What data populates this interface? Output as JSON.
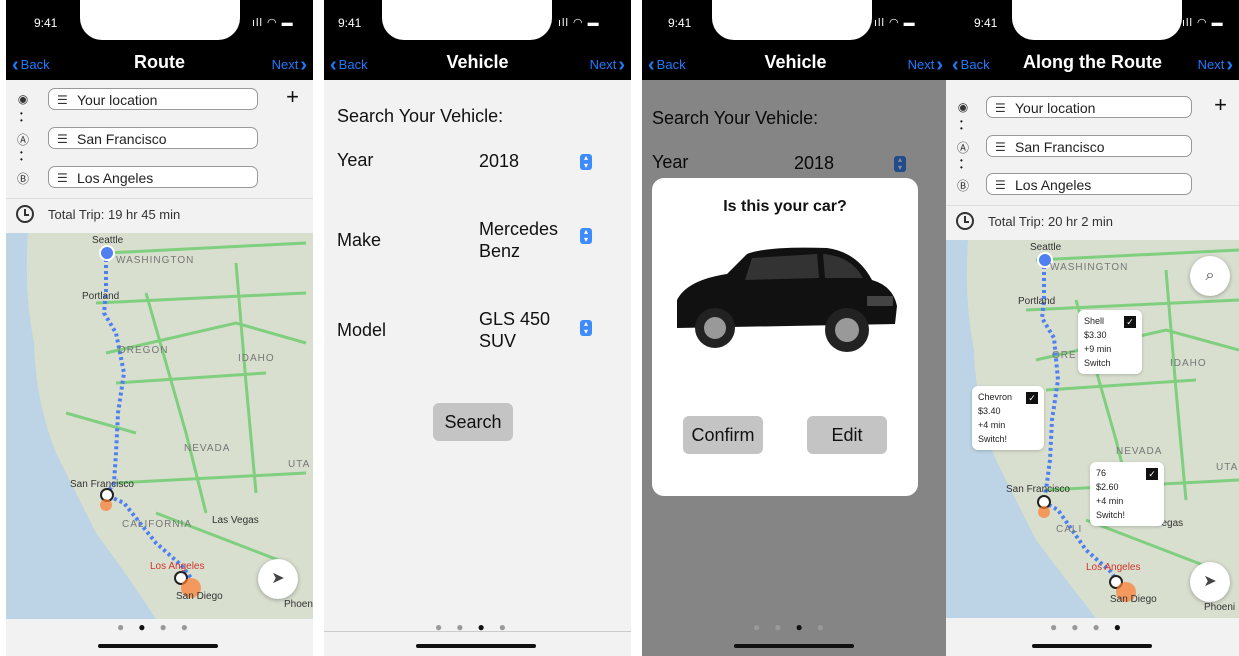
{
  "status": {
    "time": "9:41",
    "signal": "ıll"
  },
  "nav": {
    "back": "Back",
    "next": "Next"
  },
  "screens": {
    "route": {
      "title": "Route",
      "fields": [
        "Your location",
        "San Francisco",
        "Los Angeles"
      ],
      "markers": [
        "◉",
        "Ⓐ",
        "Ⓑ"
      ],
      "trip": "Total Trip: 19 hr 45 min",
      "map_labels": {
        "seattle": "Seattle",
        "washington": "WASHINGTON",
        "portland": "Portland",
        "oregon": "OREGON",
        "idaho": "IDAHO",
        "nevada": "NEVADA",
        "sanfrancisco": "San Francisco",
        "california": "CALIFORNIA",
        "lasvegas": "Las Vegas",
        "losangeles": "Los Angeles",
        "sandiego": "San Diego",
        "phoenix": "Phoeni",
        "utah": "UTA"
      }
    },
    "vehicle": {
      "title": "Vehicle",
      "heading": "Search Your Vehicle:",
      "year_label": "Year",
      "year_value": "2018",
      "make_label": "Make",
      "make_value_1": "Mercedes",
      "make_value_2": "Benz",
      "model_label": "Model",
      "model_value_1": "GLS 450",
      "model_value_2": "SUV",
      "search_button": "Search"
    },
    "confirm": {
      "title": "Vehicle",
      "heading": "Search Your Vehicle:",
      "year_label": "Year",
      "year_value": "2018",
      "modal_title": "Is this your car?",
      "confirm_button": "Confirm",
      "edit_button": "Edit"
    },
    "along": {
      "title": "Along the Route",
      "fields": [
        "Your location",
        "San Francisco",
        "Los Angeles"
      ],
      "trip": "Total Trip: 20 hr 2 min",
      "stations": [
        {
          "name": "Shell",
          "price": "$3.30",
          "time": "+9 min",
          "action": "Switch"
        },
        {
          "name": "Chevron",
          "price": "$3.40",
          "time": "+4 min",
          "action": "Switch!"
        },
        {
          "name": "76",
          "price": "$2.60",
          "time": "+4 min",
          "action": "Switch!"
        }
      ],
      "map_labels": {
        "seattle": "Seattle",
        "washington": "WASHINGTON",
        "portland": "Portland",
        "oregon": "ORE",
        "idaho": "IDAHO",
        "nevada": "NEVADA",
        "sanfrancisco": "San Francisco",
        "california": "CALI",
        "lasvegas": "as Vegas",
        "losangeles": "Los Angeles",
        "sandiego": "San Diego",
        "phoenix": "Phoeni",
        "utah": "UTA"
      }
    }
  },
  "pager": {
    "dot": "●"
  },
  "colors": {
    "accent": "#1d7bff",
    "route": "#4f7ff0",
    "map": "#d8dfcf",
    "roads": "#7fcf7f"
  }
}
